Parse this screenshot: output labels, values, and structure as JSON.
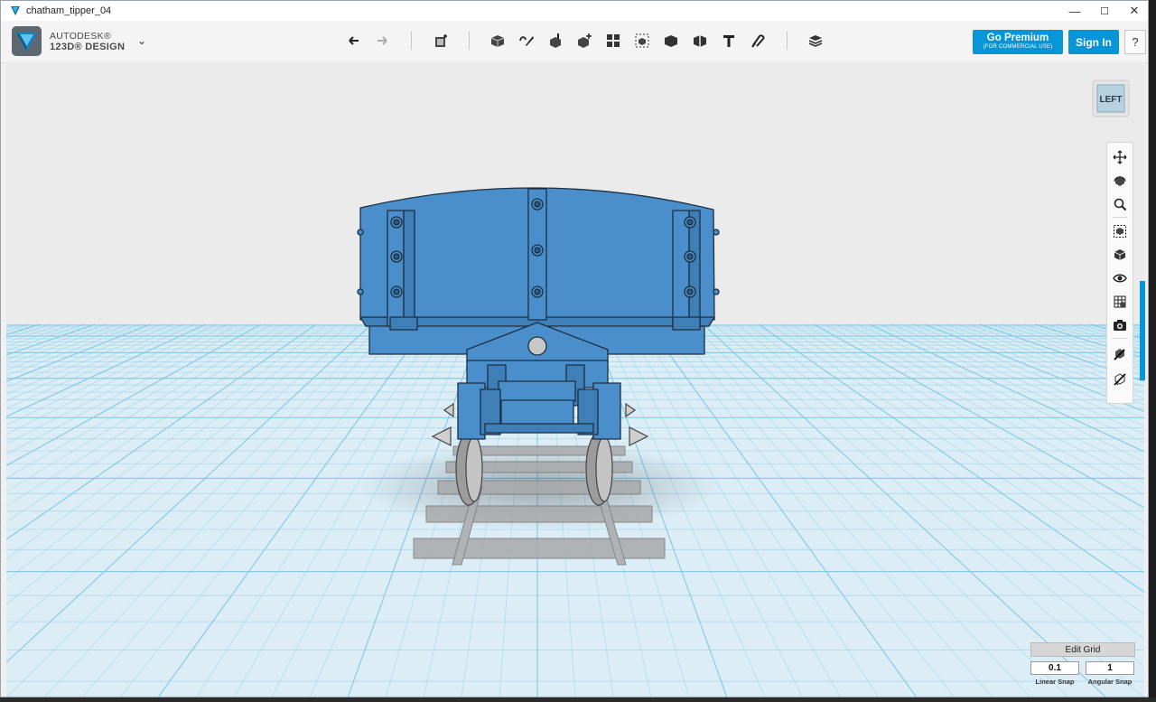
{
  "window": {
    "title": "chatham_tipper_04",
    "controls": [
      "—",
      "☐",
      "✕"
    ]
  },
  "brand": {
    "line1": "AUTODESK®",
    "line2": "123D® DESIGN",
    "menu_caret": "⌄"
  },
  "toolbar": {
    "tools": [
      {
        "name": "undo-icon"
      },
      {
        "name": "redo-icon"
      },
      {
        "name": "transform-icon"
      },
      {
        "name": "primitives-icon"
      },
      {
        "name": "sketch-icon"
      },
      {
        "name": "construct-icon"
      },
      {
        "name": "modify-icon"
      },
      {
        "name": "pattern-icon"
      },
      {
        "name": "grouping-icon"
      },
      {
        "name": "combine-icon"
      },
      {
        "name": "measure-icon"
      },
      {
        "name": "text-icon"
      },
      {
        "name": "snap-icon"
      },
      {
        "name": "material-icon"
      }
    ]
  },
  "account": {
    "premium_label": "Go Premium",
    "premium_sub": "(FOR COMMERCIAL USE)",
    "signin_label": "Sign In",
    "help_label": "?"
  },
  "viewcube": {
    "face": "LEFT"
  },
  "nav_tools": [
    "pan-icon",
    "orbit-icon",
    "zoom-icon",
    "fit-icon",
    "view-mode-icon",
    "visibility-icon",
    "material-grid-icon",
    "screenshot-icon",
    "snap-tool-icon",
    "measure-tool-icon"
  ],
  "grid": {
    "edit_label": "Edit Grid",
    "linear_snap_value": "0.1",
    "linear_snap_label": "Linear Snap",
    "angular_snap_value": "1",
    "angular_snap_label": "Angular Snap"
  },
  "colors": {
    "model_blue": "#4a8fcb",
    "accent": "#0696d7",
    "grid_line": "#7fc8e6"
  }
}
